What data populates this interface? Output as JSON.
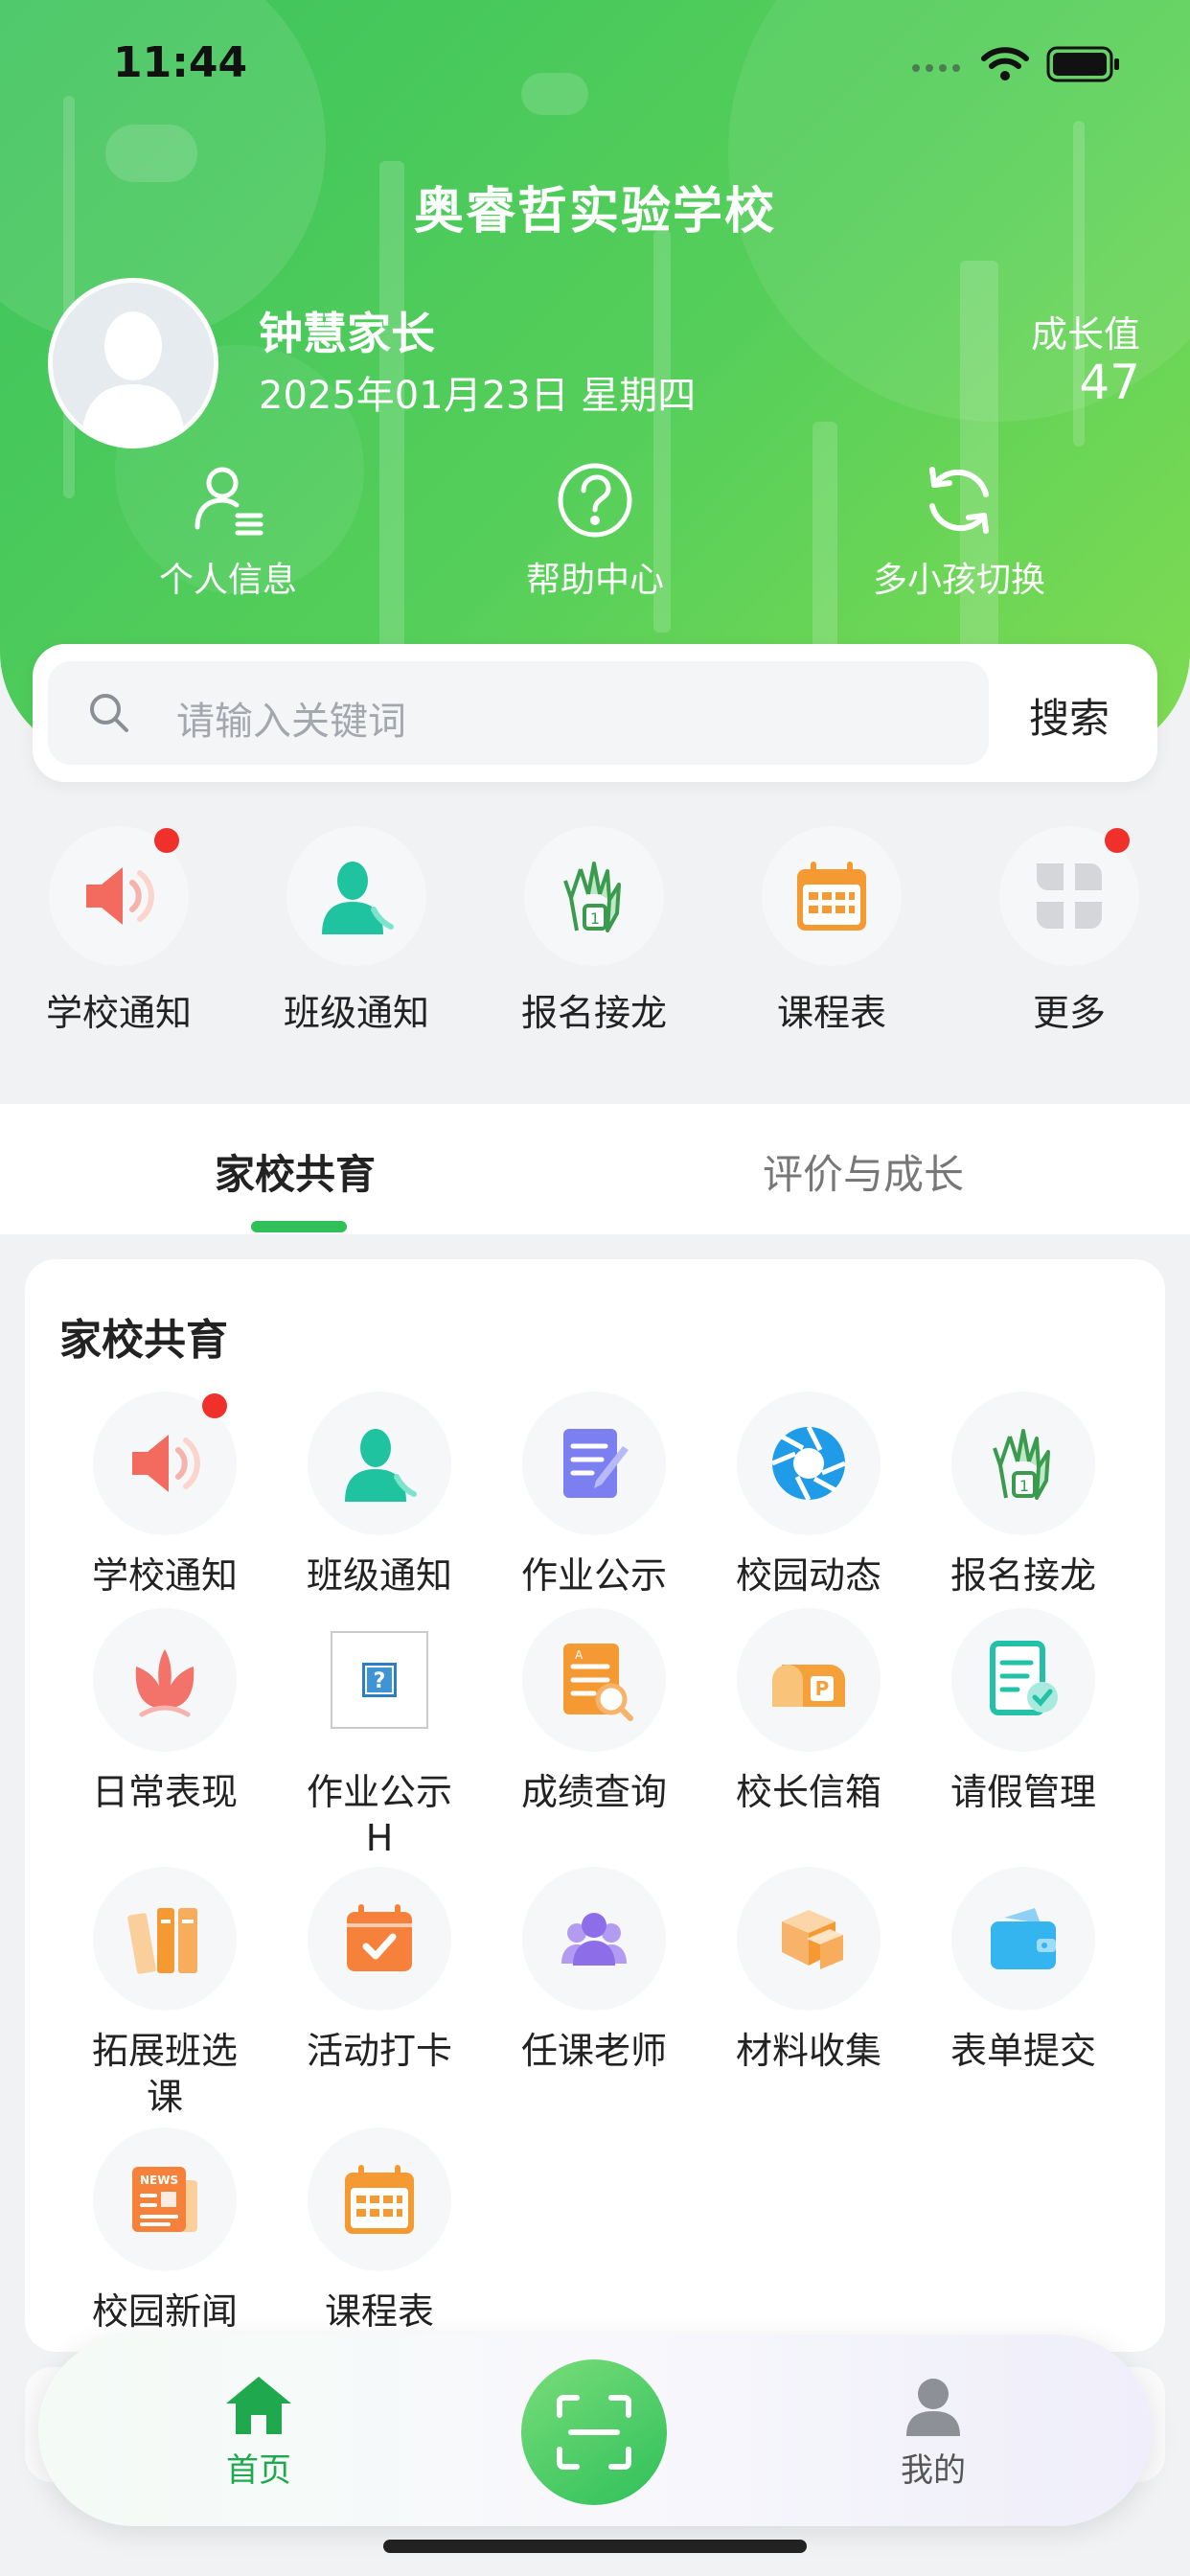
{
  "colors": {
    "brand_green": "#2fc05a",
    "badge_red": "#f0312b",
    "header_gradient_start": "#3cc35c",
    "header_gradient_end": "#7fdb52"
  },
  "status_bar": {
    "time": "11:44"
  },
  "header": {
    "school_name": "奥睿哲实验学校",
    "user_name": "钟慧家长",
    "date": "2025年01月23日 星期四",
    "growth_label": "成长值",
    "growth_value": "47",
    "actions": [
      {
        "label": "个人信息",
        "icon": "person-list-icon"
      },
      {
        "label": "帮助中心",
        "icon": "question-circle-icon"
      },
      {
        "label": "多小孩切换",
        "icon": "refresh-icon"
      }
    ]
  },
  "search": {
    "placeholder": "请输入关键词",
    "button_label": "搜索"
  },
  "quick_menu": [
    {
      "label": "学校通知",
      "icon": "speaker-icon",
      "badge": true
    },
    {
      "label": "班级通知",
      "icon": "contact-person-icon",
      "badge": false
    },
    {
      "label": "报名接龙",
      "icon": "raise-hand-icon",
      "badge": false
    },
    {
      "label": "课程表",
      "icon": "calendar-icon",
      "badge": false
    },
    {
      "label": "更多",
      "icon": "more-grid-icon",
      "badge": true
    }
  ],
  "tabs": [
    {
      "label": "家校共育",
      "active": true
    },
    {
      "label": "评价与成长",
      "active": false
    }
  ],
  "section": {
    "title": "家校共育",
    "items": [
      {
        "label": "学校通知",
        "icon": "speaker-icon",
        "badge": true
      },
      {
        "label": "班级通知",
        "icon": "contact-person-icon",
        "badge": false
      },
      {
        "label": "作业公示",
        "icon": "document-edit-icon",
        "badge": false
      },
      {
        "label": "校园动态",
        "icon": "camera-aperture-icon",
        "badge": false
      },
      {
        "label": "报名接龙",
        "icon": "raise-hand-icon",
        "badge": false
      },
      {
        "label": "日常表现",
        "icon": "lotus-icon",
        "badge": false
      },
      {
        "label": "作业公示H",
        "icon": "broken-image-icon",
        "badge": false
      },
      {
        "label": "成绩查询",
        "icon": "report-search-icon",
        "badge": false
      },
      {
        "label": "校长信箱",
        "icon": "mailbox-icon",
        "badge": false
      },
      {
        "label": "请假管理",
        "icon": "checklist-icon",
        "badge": false
      },
      {
        "label": "拓展班选课",
        "icon": "books-icon",
        "badge": false
      },
      {
        "label": "活动打卡",
        "icon": "calendar-check-icon",
        "badge": false
      },
      {
        "label": "任课老师",
        "icon": "teachers-group-icon",
        "badge": false
      },
      {
        "label": "材料收集",
        "icon": "boxes-icon",
        "badge": false
      },
      {
        "label": "表单提交",
        "icon": "wallet-icon",
        "badge": false
      },
      {
        "label": "校园新闻",
        "icon": "newspaper-icon",
        "badge": false
      },
      {
        "label": "课程表",
        "icon": "calendar-icon",
        "badge": false
      }
    ]
  },
  "bottom_nav": {
    "items": [
      {
        "label": "首页",
        "icon": "home-icon",
        "active": true
      },
      {
        "label": "",
        "icon": "scan-icon",
        "active": false
      },
      {
        "label": "我的",
        "icon": "user-icon",
        "active": false
      }
    ]
  }
}
